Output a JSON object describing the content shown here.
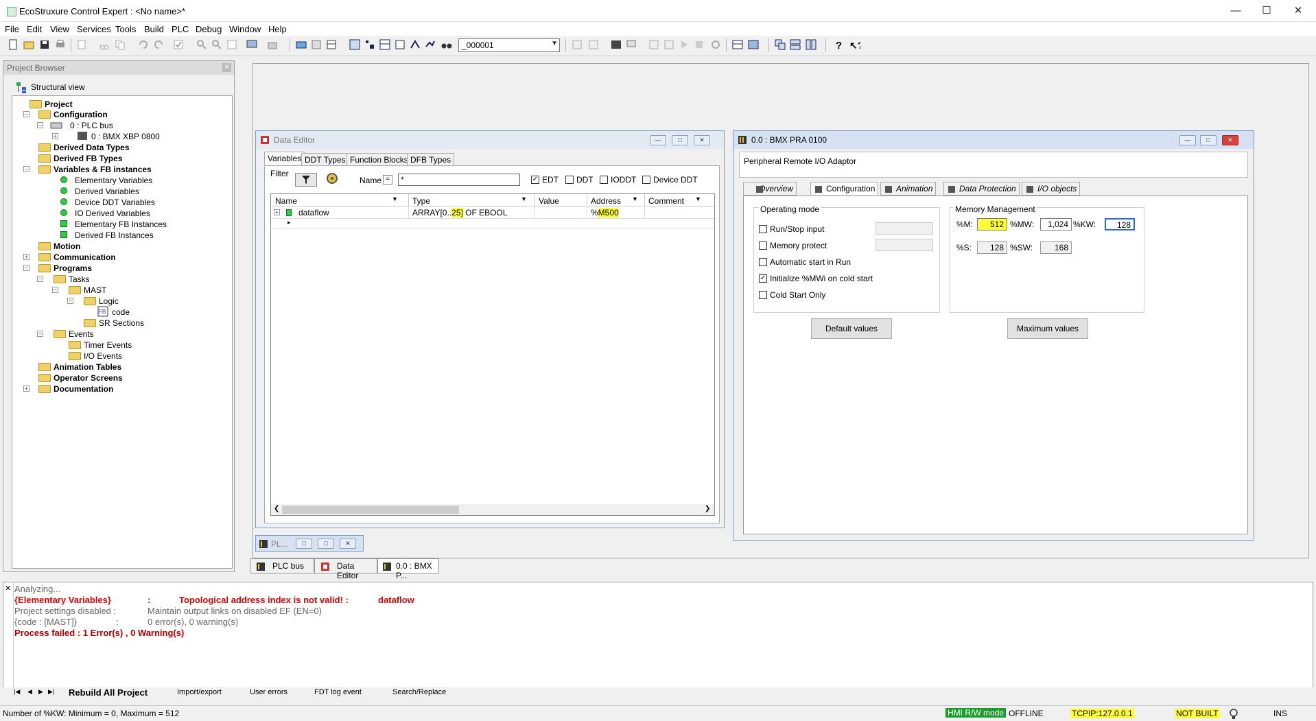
{
  "window": {
    "title": "EcoStruxure Control Expert : <No name>*"
  },
  "menu": [
    "File",
    "Edit",
    "View",
    "Services",
    "Tools",
    "Build",
    "PLC",
    "Debug",
    "Window",
    "Help"
  ],
  "toolbar": {
    "combo_value": "_000001"
  },
  "project_browser": {
    "title": "Project Browser",
    "view_label": "Structural view",
    "tree": {
      "project": "Project",
      "configuration": "Configuration",
      "plc_bus": "0 : PLC bus",
      "rack": "0 : BMX XBP 0800",
      "derived_data_types": "Derived Data Types",
      "derived_fb_types": "Derived FB Types",
      "variables_fb": "Variables & FB instances",
      "elementary_vars": "Elementary Variables",
      "derived_vars": "Derived Variables",
      "device_ddt_vars": "Device DDT Variables",
      "io_derived_vars": "IO Derived Variables",
      "elementary_fb": "Elementary FB Instances",
      "derived_fb": "Derived FB Instances",
      "motion": "Motion",
      "communication": "Communication",
      "programs": "Programs",
      "tasks": "Tasks",
      "mast": "MAST",
      "logic": "Logic",
      "code": "code",
      "sr_sections": "SR Sections",
      "events": "Events",
      "timer_events": "Timer Events",
      "io_events": "I/O Events",
      "animation_tables": "Animation Tables",
      "operator_screens": "Operator Screens",
      "documentation": "Documentation"
    }
  },
  "data_editor": {
    "title": "Data Editor",
    "tabs": [
      "Variables",
      "DDT Types",
      "Function Blocks",
      "DFB Types"
    ],
    "filter_label": "Filter",
    "name_label": "Name",
    "eq": "=",
    "name_value": "*",
    "checks": {
      "edt": "EDT",
      "ddt": "DDT",
      "ioddt": "IODDT",
      "device_ddt": "Device DDT"
    },
    "columns": {
      "name": "Name",
      "type": "Type",
      "value": "Value",
      "address": "Address",
      "comment": "Comment"
    },
    "row": {
      "name": "dataflow",
      "type_pre": "ARRAY[0..",
      "type_hl": "25]",
      "type_post": " OF EBOOL",
      "addr_pre": "%",
      "addr_hl": "M500"
    }
  },
  "bmx_window": {
    "title": "0.0 : BMX PRA 0100",
    "subtitle": "Peripheral Remote I/O Adaptor",
    "tabs": [
      "Overview",
      "Configuration",
      "Animation",
      "Data Protection",
      "I/O objects"
    ],
    "operating_mode": {
      "title": "Operating mode",
      "run_stop": "Run/Stop input",
      "mem_protect": "Memory protect",
      "auto_start": "Automatic start in Run",
      "init_mwi": "Initialize %MWi on cold start",
      "cold_start": "Cold Start Only"
    },
    "memory": {
      "title": "Memory Management",
      "m_label": "%M:",
      "m_value": "512",
      "mw_label": "%MW:",
      "mw_value": "1,024",
      "kw_label": "%KW:",
      "kw_value": "128",
      "s_label": "%S:",
      "s_value": "128",
      "sw_label": "%SW:",
      "sw_value": "168"
    },
    "default_btn": "Default values",
    "max_btn": "Maximum values"
  },
  "minimized": {
    "label": "PL..."
  },
  "bottom_tabs": [
    "PLC bus",
    "Data Editor",
    "0.0 : BMX P..."
  ],
  "output": {
    "line1": "Analyzing...",
    "line2_a": "{Elementary Variables}",
    "line2_b": ":",
    "line2_c": "Topological address index is not valid! :",
    "line2_d": "dataflow",
    "line3_a": "Project settings disabled :",
    "line3_b": "Maintain output links on disabled EF (EN=0)",
    "line4_a": "{code : [MAST]}",
    "line4_b": ":",
    "line4_c": "0 error(s), 0 warning(s)",
    "line5": "Process failed : 1 Error(s) , 0 Warning(s)",
    "tabs": [
      "Rebuild All Project",
      "Import/export",
      "User errors",
      "FDT log event",
      "Search/Replace"
    ]
  },
  "status": {
    "left": "Number of %KW: Minimum = 0, Maximum = 512",
    "hmi": "HMI R/W mode",
    "offline": "OFFLINE",
    "tcpip": "TCPIP:127.0.0.1",
    "not_built": "NOT BUILT",
    "ins": "INS"
  }
}
